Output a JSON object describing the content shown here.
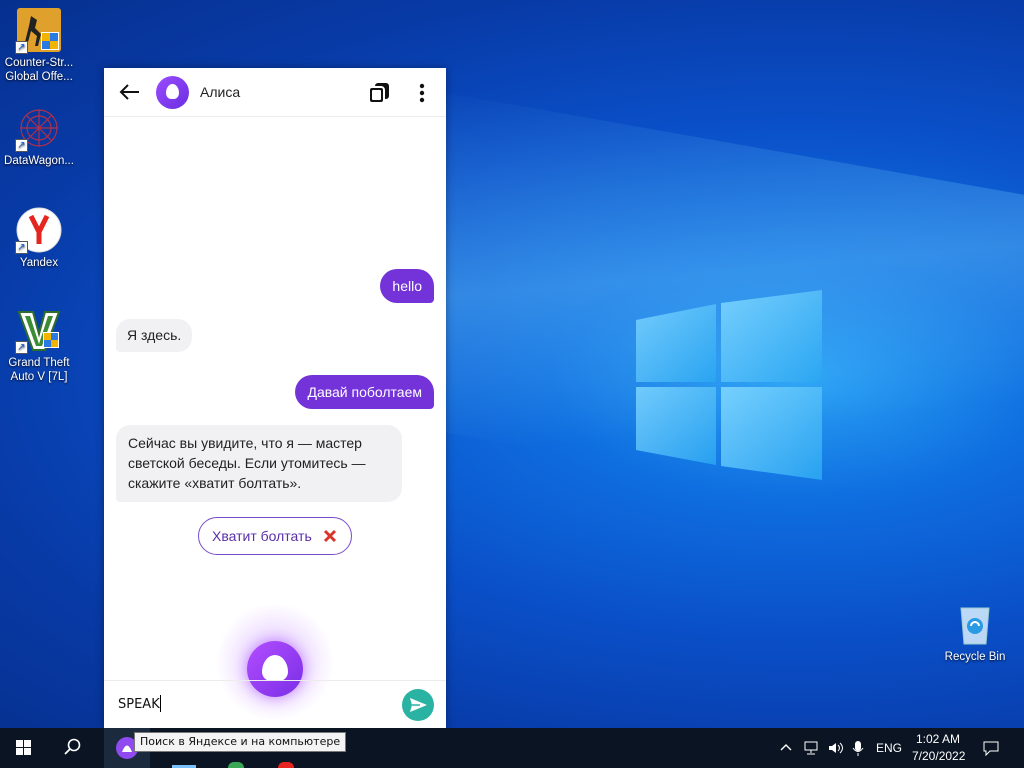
{
  "desktop": {
    "icons": [
      {
        "label": "Counter-Str... Global Offe...",
        "line1": "Counter-Str...",
        "line2": "Global Offe..."
      },
      {
        "label": "DataWagon...",
        "line1": "DataWagon...",
        "line2": ""
      },
      {
        "label": "Yandex",
        "line1": "Yandex",
        "line2": ""
      },
      {
        "label": "Grand Theft Auto V [7L]",
        "line1": "Grand Theft",
        "line2": "Auto V [7L]"
      }
    ],
    "recycle_bin": {
      "label": "Recycle Bin"
    }
  },
  "alice": {
    "title": "Алиса",
    "messages": [
      {
        "from": "user",
        "text": "hello"
      },
      {
        "from": "alice",
        "text": "Я здесь."
      },
      {
        "from": "user",
        "text": "Давай поболтаем"
      },
      {
        "from": "alice",
        "text": "Сейчас вы увидите, что я — мастер светской беседы. Если утомитесь — скажите «хватит болтать».",
        "lines": [
          "Сейчас вы увидите, что я — мастер",
          "светской беседы. Если утомитесь —",
          "скажите «хватит болтать»."
        ]
      }
    ],
    "suggestion_chip": "Хватит болтать",
    "input_value": "SPEAK"
  },
  "taskbar": {
    "search_tooltip": "Поиск в Яндексе и на компьютере",
    "language": "ENG",
    "time": "1:02 AM",
    "date": "7/20/2022"
  },
  "colors": {
    "accent_purple": "#7433d9",
    "send_teal": "#2ab3a2",
    "taskbar": "#0b1422"
  }
}
